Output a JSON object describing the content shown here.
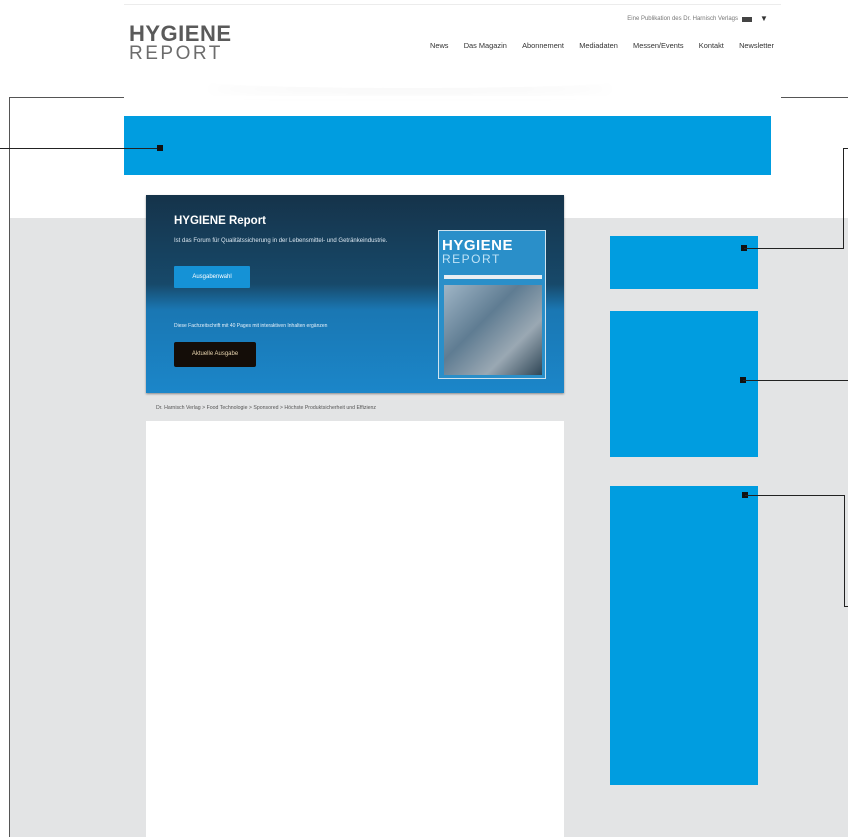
{
  "header": {
    "logo_line1": "HYGIENE",
    "logo_line2": "REPORT",
    "publisher_line": "Eine Publikation des Dr. Harnisch Verlags",
    "nav": [
      "News",
      "Das Magazin",
      "Abonnement",
      "Mediadaten",
      "Messen/Events",
      "Kontakt",
      "Newsletter"
    ]
  },
  "banner": {
    "title": "HYGIENE Report",
    "subtitle": "Ist das Forum für Qualitätssicherung in der Lebensmittel- und Getränkeindustrie.",
    "issue_button": "Ausgabenwahl",
    "note": "Diese Fachzeitschrift mit 40 Pages mit interaktiven Inhalten ergänzen",
    "current_button": "Aktuelle Ausgabe",
    "cover_title": "HYGIENE",
    "cover_subtitle": "REPORT"
  },
  "breadcrumb": "Dr. Harnisch Verlag > Food Technologie > Sponsored > Höchste Produktsicherheit und Effizienz",
  "colors": {
    "ad_blue": "#009de0",
    "content_gray": "#e3e4e5",
    "banner_dark": "#15334a"
  }
}
